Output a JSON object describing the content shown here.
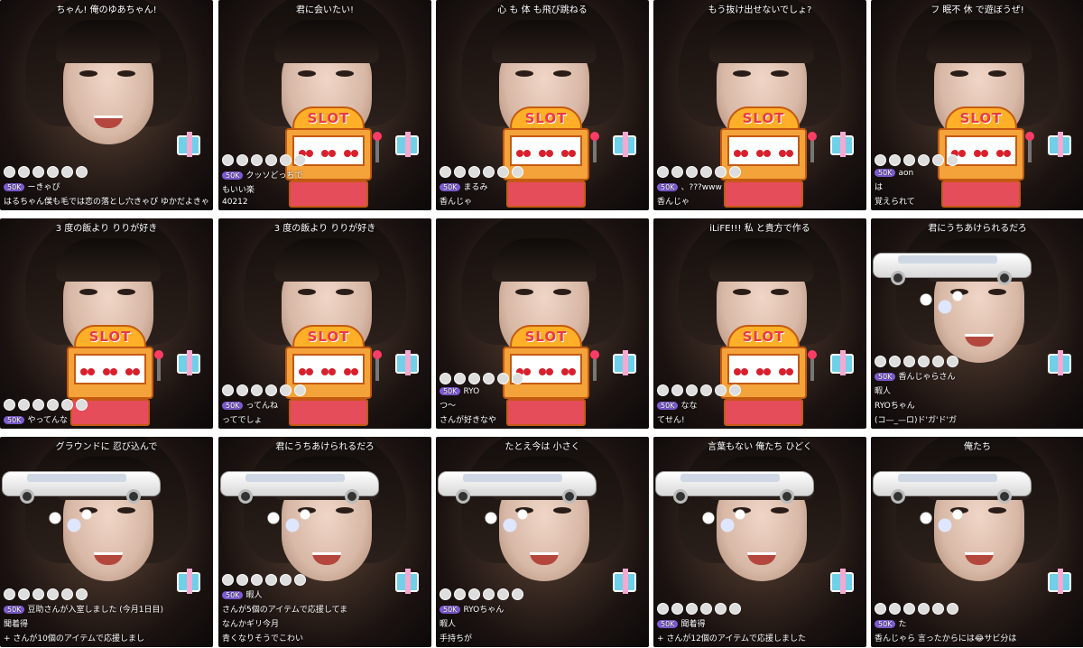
{
  "tiles": [
    {
      "caption": "ちゃん! 俺のゆあちゃん!",
      "overlay": "none",
      "chat": [
        "ーきゃぴ",
        "はるちゃん僕も毛では恋の落とし穴きゃぴ ゆかだよきゃぴ"
      ]
    },
    {
      "caption": "君に会いたい!",
      "overlay": "slot",
      "chat": [
        "クッソどっちで",
        "もいい楽",
        "40212"
      ]
    },
    {
      "caption": "心 も 体 も飛び跳ねる",
      "overlay": "slot",
      "chat": [
        "まるみ",
        "香んじゃ"
      ]
    },
    {
      "caption": "もう抜け出せないでしょ?",
      "overlay": "slot",
      "chat": [
        "、???www",
        "香んじゃ"
      ]
    },
    {
      "caption": "フ 眠不 休 で遊ぼうぜ!",
      "overlay": "slot",
      "chat": [
        "aon",
        "は",
        "覚えられて"
      ]
    },
    {
      "caption": "3 度の飯より りりが好き",
      "overlay": "slot",
      "chat": [
        "やってんな"
      ]
    },
    {
      "caption": "3 度の飯より りりが好き",
      "overlay": "slot",
      "chat": [
        "ってんね",
        "ってでしょ"
      ]
    },
    {
      "caption": "",
      "overlay": "slot",
      "chat": [
        "RYO",
        "つ〜",
        "さんが好きなや"
      ]
    },
    {
      "caption": "iLiFE!!! 私 と貴方で作る",
      "overlay": "slot",
      "chat": [
        "なな",
        "てせん!"
      ]
    },
    {
      "caption": "君にうちあけられるだろ",
      "overlay": "limo",
      "chat": [
        "香んじゃらさん",
        "暇人",
        "RYOちゃん",
        "(コ—_—ロ)ド'ガ'ド'ガ"
      ]
    },
    {
      "caption": "グラウンドに 忍び込んで",
      "overlay": "limo",
      "chat": [
        "豆助さんが入室しました (今月1日目)",
        "聞着得",
        "+ さんが10個のアイテムで応援しまし"
      ]
    },
    {
      "caption": "君にうちあけられるだろ",
      "overlay": "limo",
      "chat": [
        "暇人",
        "さんが5個のアイテムで応援してま",
        "なんかギリ今月",
        "青くなりそうでこわい"
      ]
    },
    {
      "caption": "たとえ今は 小さく",
      "overlay": "limo",
      "chat": [
        "RYOちゃん",
        "暇人",
        "手持ちが"
      ]
    },
    {
      "caption": "言葉もない 俺たち ひどく",
      "overlay": "limo",
      "chat": [
        "聞着得",
        "+ さんが12個のアイテムで応援しました"
      ]
    },
    {
      "caption": "俺たち",
      "overlay": "limo",
      "chat": [
        "た",
        "香んじゃら 言ったからには😂サビ分は"
      ]
    }
  ],
  "badges": {
    "lv": "50K",
    "slot_label": "SLOT"
  }
}
